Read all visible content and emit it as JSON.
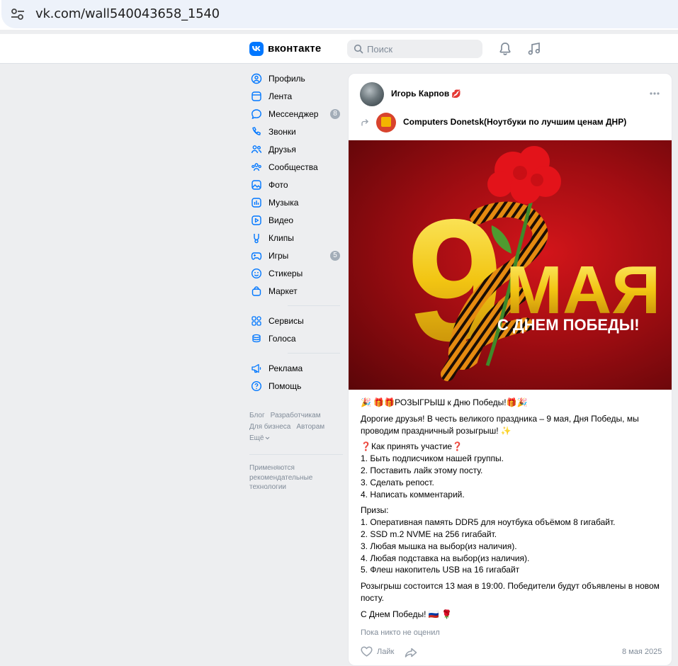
{
  "browser": {
    "url": "vk.com/wall540043658_1540",
    "site_info_icon": "tune-icon"
  },
  "header": {
    "logo_letter": "VK",
    "wordmark": "вконтакте",
    "search_placeholder": "Поиск",
    "icons": [
      "bell-icon",
      "music-note-icon"
    ],
    "accent_color": "#0077ff"
  },
  "sidebar": {
    "items": [
      {
        "label": "Профиль",
        "icon": "user-circle-icon"
      },
      {
        "label": "Лента",
        "icon": "newsfeed-icon"
      },
      {
        "label": "Мессенджер",
        "icon": "message-icon",
        "badge": "8"
      },
      {
        "label": "Звонки",
        "icon": "phone-icon"
      },
      {
        "label": "Друзья",
        "icon": "friends-icon"
      },
      {
        "label": "Сообщества",
        "icon": "communities-icon"
      },
      {
        "label": "Фото",
        "icon": "photo-icon"
      },
      {
        "label": "Музыка",
        "icon": "music-icon"
      },
      {
        "label": "Видео",
        "icon": "video-icon"
      },
      {
        "label": "Клипы",
        "icon": "clips-icon"
      },
      {
        "label": "Игры",
        "icon": "gamepad-icon",
        "badge": "5"
      },
      {
        "label": "Стикеры",
        "icon": "smile-icon"
      },
      {
        "label": "Маркет",
        "icon": "shopping-bag-icon"
      }
    ],
    "items2": [
      {
        "label": "Сервисы",
        "icon": "services-icon"
      },
      {
        "label": "Голоса",
        "icon": "coins-icon"
      }
    ],
    "items3": [
      {
        "label": "Реклама",
        "icon": "megaphone-icon"
      },
      {
        "label": "Помощь",
        "icon": "help-icon"
      }
    ],
    "footer_links": [
      "Блог",
      "Разработчикам",
      "Для бизнеса",
      "Авторам",
      "Ещё"
    ],
    "recommendation_note": "Применяются рекомендательные технологии"
  },
  "post": {
    "author": "Игорь Карпов",
    "author_emoji": "💋",
    "group_name": "Computers Donetsk(Ноутбуки по лучшим ценам ДНР)",
    "image": {
      "big_number": "9",
      "month": "МАЯ",
      "greeting": "С ДНЕМ ПОБЕДЫ!"
    },
    "paragraphs": [
      "🎉 🎁🎁РОЗЫГРЫШ к Дню Победы!🎁🎉",
      "Дорогие друзья! В честь великого праздника – 9 мая, Дня Победы, мы проводим праздничный розыгрыш! ✨",
      "❓Как принять участие❓\n1. Быть подписчиком нашей группы.\n2. Поставить лайк этому посту.\n3. Сделать репост.\n4. Написать комментарий.",
      "Призы:\n1. Оперативная память DDR5 для ноутбука объёмом 8 гигабайт.\n2. SSD m.2 NVME на 256 гигабайт.\n3. Любая мышка на выбор(из наличия).\n4. Любая подставка на выбор(из наличия).\n5. Флеш накопитель USB на 16 гигабайт",
      "Розыгрыш состоится 13 мая в 19:00. Победители будут объявлены в новом посту.",
      "С Днем Победы! 🇷🇺 🌹"
    ],
    "likes_note": "Пока никто не оценил",
    "like_label": "Лайк",
    "date": "8 мая 2025"
  }
}
